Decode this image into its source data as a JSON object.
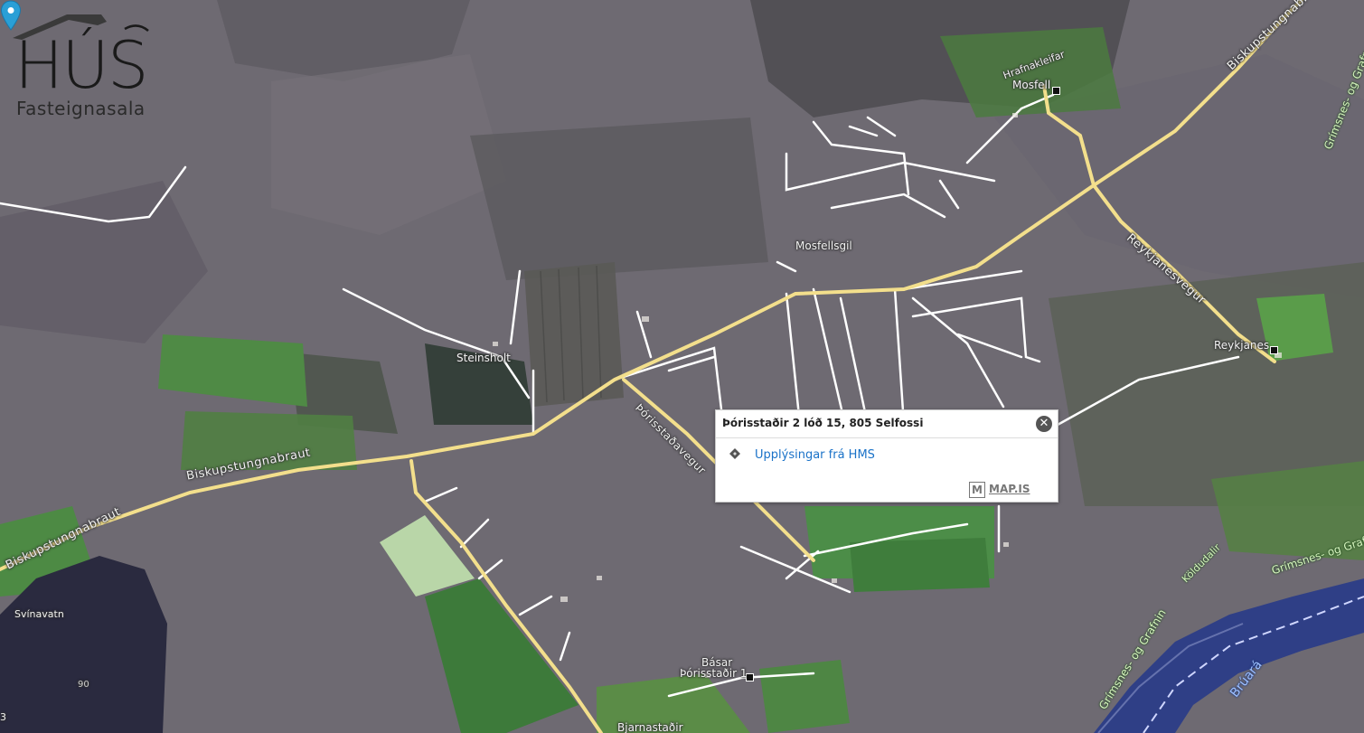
{
  "logo": {
    "main": "HÚS",
    "sub": "Fasteignasala"
  },
  "map": {
    "labels": {
      "biskupstungnabraut_1": "Biskupstungnabraut",
      "biskupstungnabraut_2": "Biskupstungnabraut",
      "biskupstungnabraut_3": "Biskupstungnabraut",
      "hrafnakleifar": "Hrafnakleifar",
      "mosfell": "Mosfell",
      "mosfellsgil": "Mosfellsgil",
      "steinsholt": "Steinsholt",
      "reykjanesvegur": "Reykjanesvegur",
      "reykjanes": "Reykjanes",
      "grimsnes_top": "Grímsnes- og Grafn",
      "grimsnes_right": "Grímsnes- og Graf",
      "grimsnes_bottom": "Grímsnes- og Grafnin",
      "koldudalir": "Köldudalir",
      "svinavatn": "Svínavatn",
      "elev_90": "90",
      "thorisstadavegur": "Þórisstaðavegur",
      "basar": "Básar",
      "thorisstadir_1": "Þórisstaðir 1",
      "bjarnastadir": "Bjarnastaðir",
      "bruara": "Brúará",
      "edge_3": "3"
    },
    "colors": {
      "terrain": "#6e6a72",
      "road_main": "#f3df8c",
      "road_minor": "#ffffff",
      "field_green": "#4f8a45",
      "river": "#2f3f86",
      "pin": "#2a9fd6"
    }
  },
  "popup": {
    "title": "Þórisstaðir 2 lóð 15, 805 Selfossi",
    "link_text": "Upplýsingar frá HMS",
    "close_symbol": "✕",
    "brand_letter": "M",
    "brand_text": "MAP.IS"
  }
}
